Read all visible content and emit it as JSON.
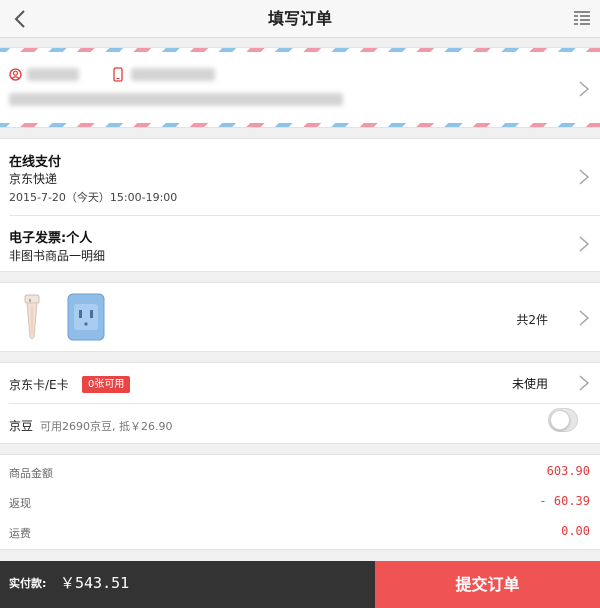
{
  "header": {
    "title": "填写订单"
  },
  "payment": {
    "method": "在线支付",
    "shipping": "京东快递",
    "delivery_time": "2015-7-20（今天）15:00-19:00"
  },
  "invoice": {
    "title": "电子发票:个人",
    "detail": "非图书商品一明细"
  },
  "goods": {
    "count_label": "共2件"
  },
  "cards": {
    "label": "京东卡/E卡",
    "badge": "0张可用",
    "status": "未使用"
  },
  "jingdou": {
    "label": "京豆",
    "hint": "可用2690京豆, 抵￥26.90"
  },
  "totals": {
    "rows": [
      {
        "label": "商品金额",
        "value": "603.90"
      },
      {
        "label": "返现",
        "value": "- 60.39"
      },
      {
        "label": "运费",
        "value": "0.00"
      }
    ]
  },
  "footer": {
    "paid_label": "实付款:",
    "amount": "￥543.51",
    "submit": "提交订单"
  },
  "colors": {
    "accent": "#e4393c",
    "submit_bg": "#f05354",
    "footer_bg": "#333333"
  }
}
